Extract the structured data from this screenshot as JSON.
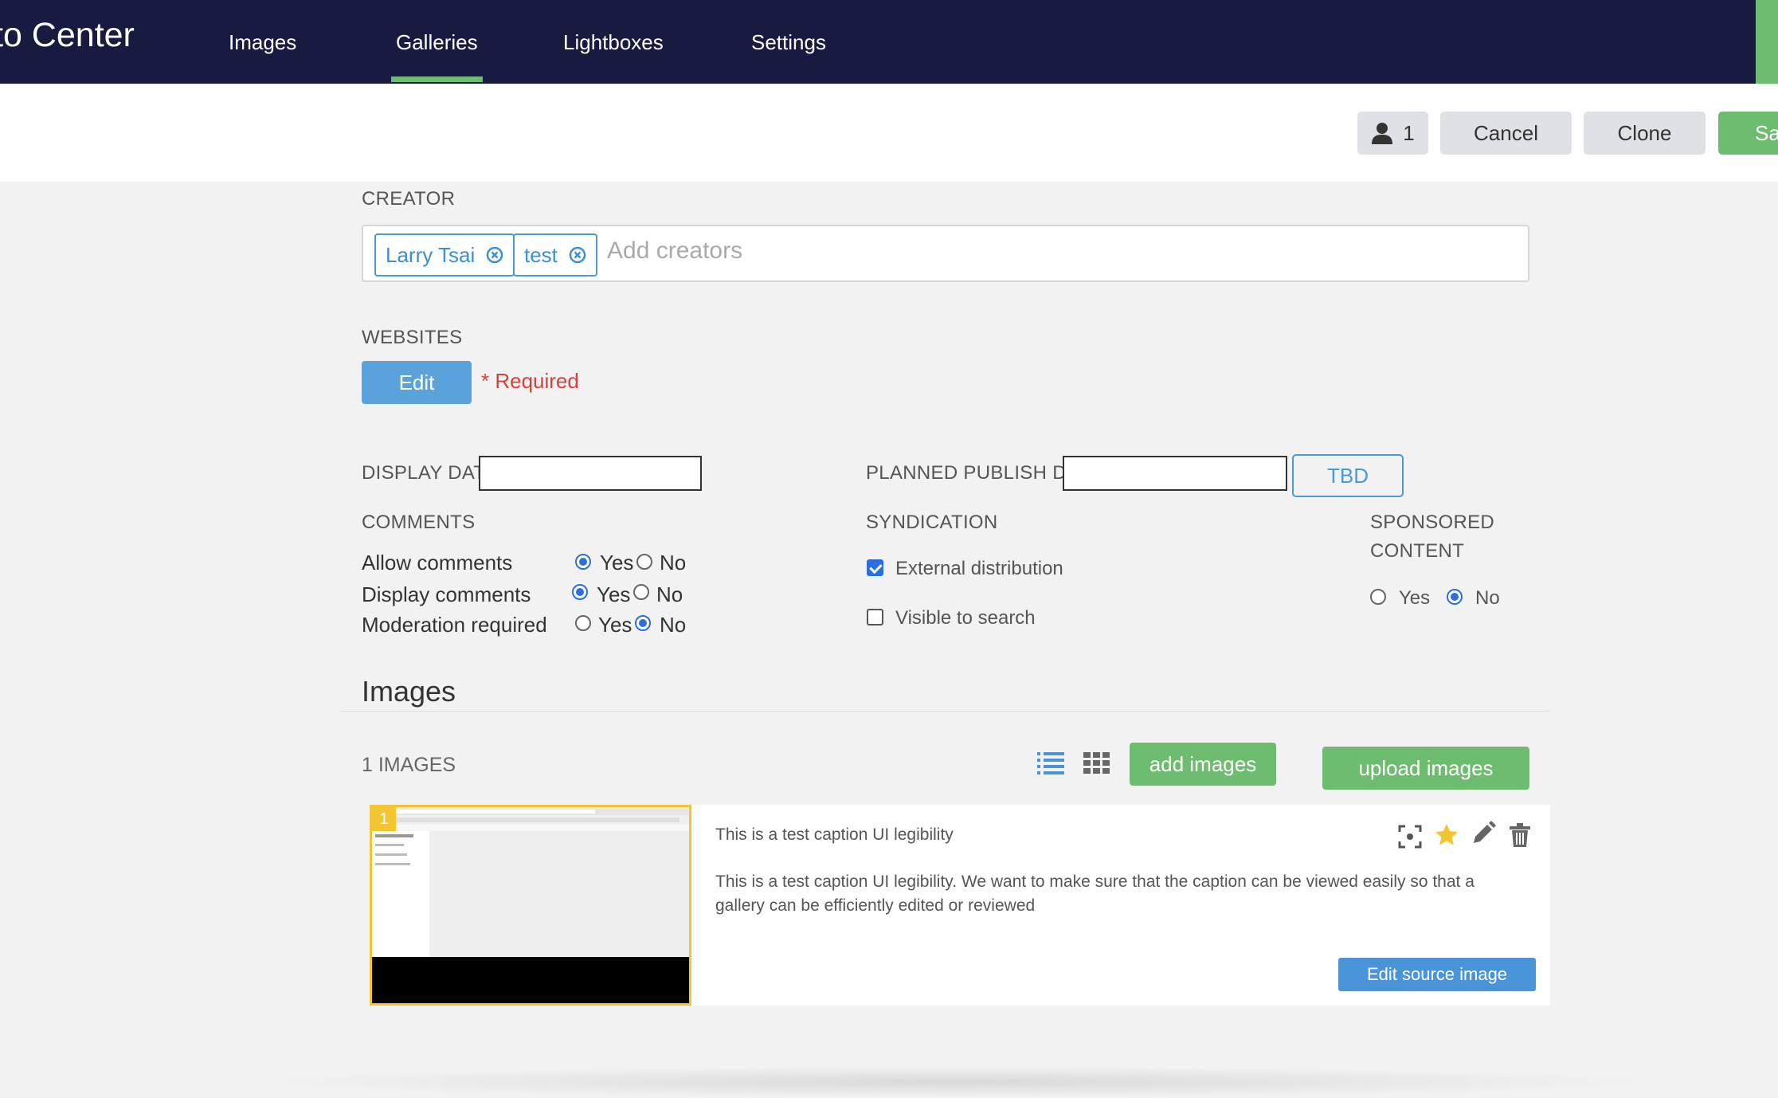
{
  "app": {
    "brand_title": "to Center"
  },
  "nav": {
    "tabs": [
      {
        "label": "Images",
        "active": false
      },
      {
        "label": "Galleries",
        "active": true
      },
      {
        "label": "Lightboxes",
        "active": false
      },
      {
        "label": "Settings",
        "active": false
      }
    ]
  },
  "toolbar": {
    "users_count": "1",
    "users_icon": "user-icon",
    "cancel_label": "Cancel",
    "clone_label": "Clone",
    "save_label": "Sa"
  },
  "creator": {
    "label": "CREATOR",
    "chips": [
      "Larry Tsai",
      "test"
    ],
    "placeholder": "Add creators"
  },
  "websites": {
    "label": "WEBSITES",
    "edit_label": "Edit",
    "required_text": "* Required"
  },
  "dates": {
    "display_date_label": "DISPLAY DATE",
    "display_date_value": "",
    "planned_publish_label": "PLANNED PUBLISH DATE",
    "planned_publish_value": "",
    "tbd_label": "TBD"
  },
  "comments": {
    "label": "COMMENTS",
    "rows": [
      {
        "label": "Allow comments",
        "yes": "Yes",
        "no": "No",
        "value": "Yes"
      },
      {
        "label": "Display comments",
        "yes": "Yes",
        "no": "No",
        "value": "Yes"
      },
      {
        "label": "Moderation required",
        "yes": "Yes",
        "no": "No",
        "value": "No"
      }
    ]
  },
  "syndication": {
    "label": "SYNDICATION",
    "options": [
      {
        "label": "External distribution",
        "checked": true
      },
      {
        "label": "Visible to search",
        "checked": false
      }
    ]
  },
  "sponsored": {
    "label_line1": "SPONSORED",
    "label_line2": "CONTENT",
    "yes": "Yes",
    "no": "No",
    "value": "No"
  },
  "images": {
    "section_title": "Images",
    "count_label": "1 IMAGES",
    "add_label": "add images",
    "upload_label": "upload images",
    "items": [
      {
        "number": "1",
        "caption_short": "This is a test caption UI legibility",
        "caption_long": "This is a test caption UI legibility. We want to make sure that the caption can be viewed easily so that a gallery can be efficiently edited or reviewed",
        "edit_source_label": "Edit source image",
        "featured": true
      }
    ]
  },
  "colors": {
    "nav_bg": "#161b3f",
    "accent_green": "#6ebc6f",
    "accent_blue": "#4a94d8",
    "required_red": "#d9403a",
    "featured_star": "#f3c531"
  }
}
